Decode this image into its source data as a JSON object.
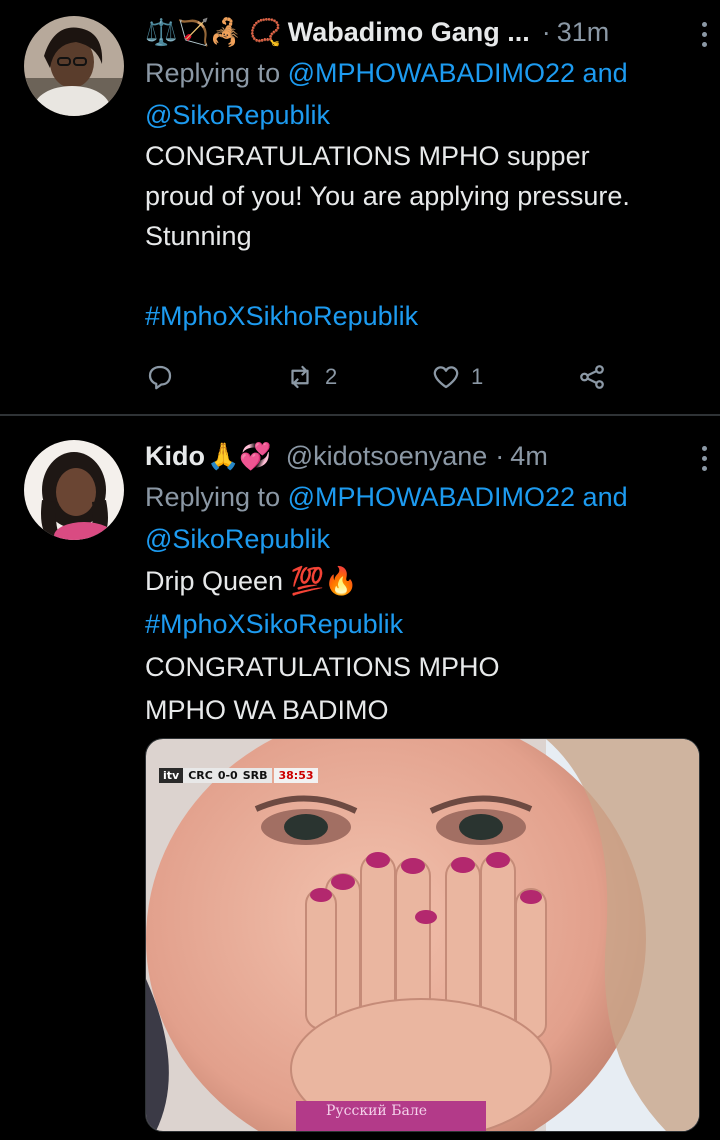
{
  "tweets": [
    {
      "emojis": "⚖️🏹🦂 📿",
      "name": "Wabadimo Gang ...",
      "handle": "",
      "time": "31m",
      "reply_prefix": "Replying to",
      "reply_mentions": "@MPHOWABADIMO22 and",
      "reply_mentions_2": "@SikoRepublik",
      "body_lines": [
        "CONGRATULATIONS MPHO supper",
        "proud of you! You are applying pressure.",
        "Stunning"
      ],
      "hashtag": "#MphoXSikhoRepublik",
      "retweets": "2",
      "likes": "1"
    },
    {
      "name": "Kido",
      "emojis": "🙏💞",
      "handle": "@kidotsoenyane",
      "time": "4m",
      "reply_prefix": "Replying to",
      "reply_mentions": "@MPHOWABADIMO22 and",
      "reply_mentions_2": "@SikoRepublik",
      "line1": "Drip Queen 💯🔥",
      "hashtag": "#MphoXSikoRepublik",
      "line3": "CONGRATULATIONS MPHO",
      "line4": "MPHO WA BADIMO",
      "media": {
        "scorebug": {
          "channel": "itv",
          "home": "CRC",
          "score": "0-0",
          "away": "SRB",
          "clock": "38:53"
        },
        "wristband_text": "Русский Бале"
      }
    }
  ],
  "colors": {
    "background": "#000000",
    "link": "#1d9bf0",
    "secondary": "#8b98a5",
    "text": "#e7e9ea"
  }
}
